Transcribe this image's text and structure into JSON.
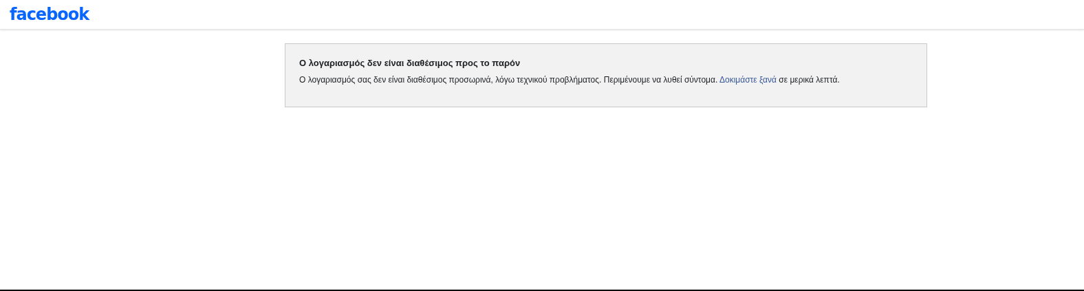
{
  "header": {
    "logo": "facebook"
  },
  "notice": {
    "title": "Ο λογαριασμός δεν είναι διαθέσιμος προς το παρόν",
    "message_before": "Ο λογαριασμός σας δεν είναι διαθέσιμος προσωρινά, λόγω τεχνικού προβλήματος. Περιμένουμε να λυθεί σύντομα.",
    "link": "Δοκιμάστε ξανά",
    "message_after": "σε μερικά λεπτά."
  }
}
